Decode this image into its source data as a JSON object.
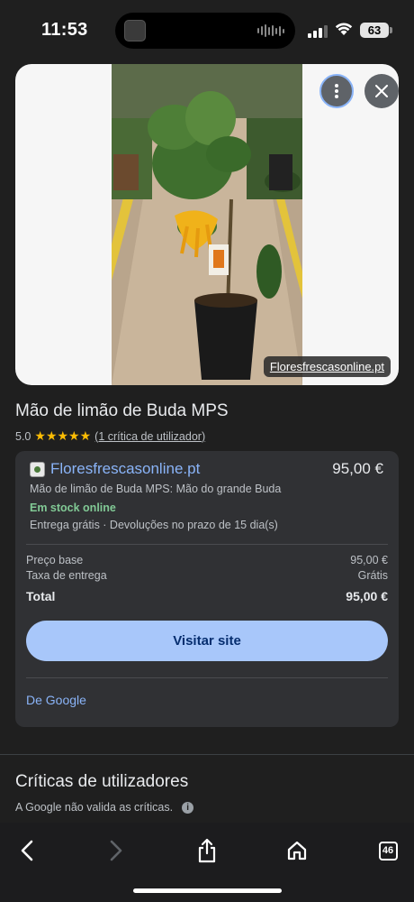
{
  "status_bar": {
    "time": "11:53",
    "battery": "63"
  },
  "image_viewer": {
    "source_label": "Floresfrescasonline.pt",
    "more_icon": "more-vert-icon",
    "close_icon": "close-icon"
  },
  "product": {
    "title": "Mão de limão de Buda MPS",
    "rating_value": "5.0",
    "stars": "★★★★★",
    "review_count_label": "(1 crítica de utilizador)"
  },
  "offer": {
    "merchant": "Floresfrescasonline.pt",
    "price": "95,00 €",
    "description": "Mão de limão de Buda MPS: Mão do grande Buda",
    "stock": "Em stock online",
    "delivery": "Entrega grátis · Devoluções no prazo de 15 dia(s)",
    "base_price_label": "Preço base",
    "base_price_value": "95,00 €",
    "delivery_fee_label": "Taxa de entrega",
    "delivery_fee_value": "Grátis",
    "total_label": "Total",
    "total_value": "95,00 €",
    "visit_button": "Visitar site",
    "from_google": "De Google"
  },
  "reviews": {
    "title": "Críticas de utilizadores",
    "note": "A Google não valida as críticas."
  },
  "toolbar": {
    "tabs_count": "46"
  },
  "colors": {
    "background": "#1f1f1f",
    "card": "#303134",
    "link_blue": "#8ab4f8",
    "button_blue": "#a8c7fa",
    "stock_green": "#81c995",
    "star_yellow": "#fbbc04"
  }
}
